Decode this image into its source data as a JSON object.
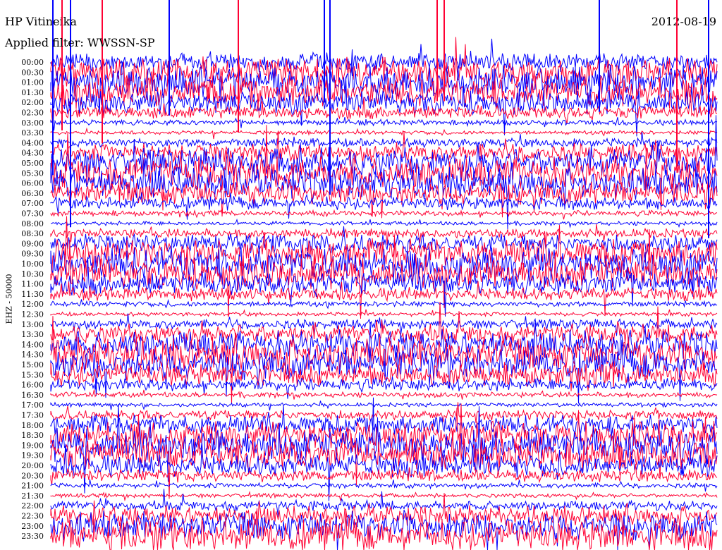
{
  "header": {
    "station": "HP Vitineika",
    "filter": "Applied filter: WWSSN-SP",
    "date": "2012-08-19",
    "channel": "EHZ - 50000"
  },
  "colors": {
    "trace_a": "#0000ff",
    "trace_b": "#ff0033"
  },
  "chart_data": {
    "type": "line",
    "title": "HP Vitineika",
    "subtitle": "Applied filter: WWSSN-SP",
    "ylabel": "EHZ - 50000",
    "xlabel": "",
    "rows": [
      "00:00",
      "00:30",
      "01:00",
      "01:30",
      "02:00",
      "02:30",
      "03:00",
      "03:30",
      "04:00",
      "04:30",
      "05:00",
      "05:30",
      "06:00",
      "06:30",
      "07:00",
      "07:30",
      "08:00",
      "08:30",
      "09:00",
      "09:30",
      "10:00",
      "10:30",
      "11:00",
      "11:30",
      "12:00",
      "12:30",
      "13:00",
      "13:30",
      "14:00",
      "14:30",
      "15:00",
      "15:30",
      "16:00",
      "16:30",
      "17:00",
      "17:30",
      "18:00",
      "18:30",
      "19:00",
      "19:30",
      "20:00",
      "20:30",
      "21:00",
      "21:30",
      "22:00",
      "22:30",
      "23:00",
      "23:30"
    ],
    "series": [
      {
        "name": "",
        "color": "#0000ff",
        "rows_parity": "even"
      },
      {
        "name": "",
        "color": "#ff0033",
        "rows_parity": "odd"
      }
    ],
    "grid": false,
    "legend": "none"
  }
}
